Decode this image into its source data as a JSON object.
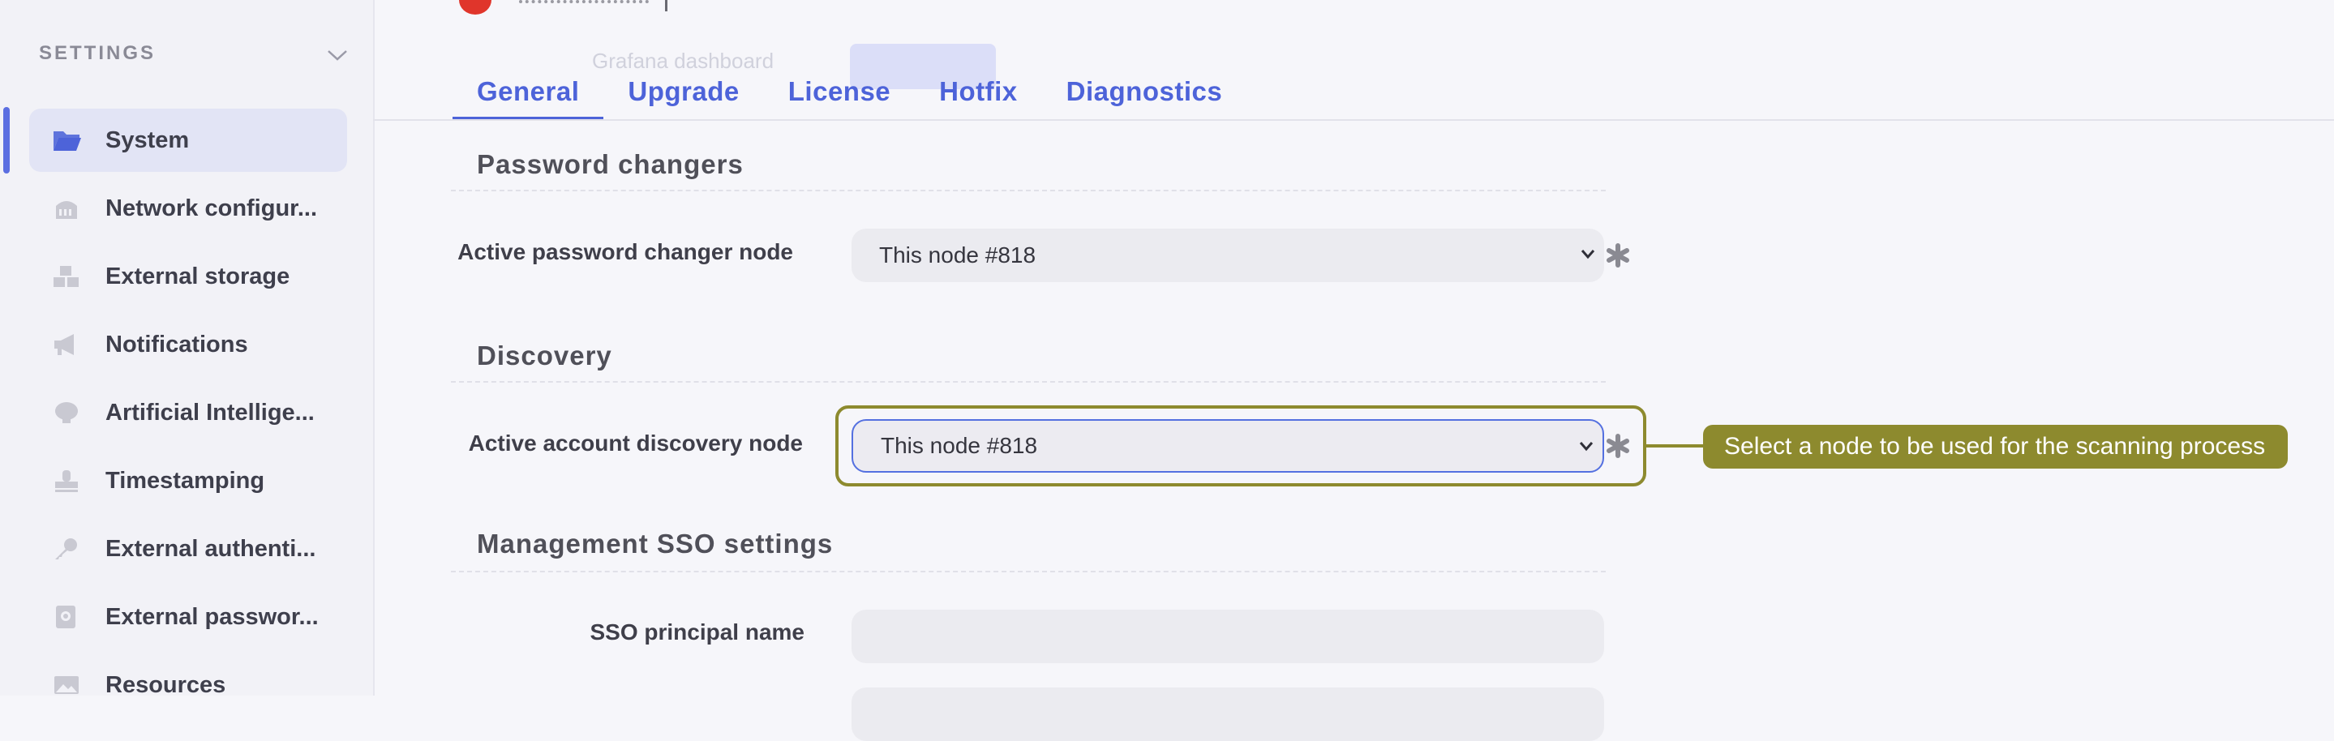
{
  "sidebar": {
    "header": "SETTINGS",
    "items": [
      {
        "label": "System",
        "icon": "folder-icon",
        "active": true
      },
      {
        "label": "Network configur...",
        "icon": "network-icon"
      },
      {
        "label": "External storage",
        "icon": "storage-boxes-icon"
      },
      {
        "label": "Notifications",
        "icon": "megaphone-icon"
      },
      {
        "label": "Artificial Intellige...",
        "icon": "brain-icon"
      },
      {
        "label": "Timestamping",
        "icon": "stamp-icon"
      },
      {
        "label": "External authenti...",
        "icon": "key-icon"
      },
      {
        "label": "External passwor...",
        "icon": "vault-icon"
      },
      {
        "label": "Resources",
        "icon": "image-icon"
      }
    ]
  },
  "background": {
    "ghost_text": "Grafana dashboard"
  },
  "tabs": [
    {
      "label": "General",
      "active": true
    },
    {
      "label": "Upgrade"
    },
    {
      "label": "License"
    },
    {
      "label": "Hotfix"
    },
    {
      "label": "Diagnostics"
    }
  ],
  "sections": {
    "password_changers": {
      "title": "Password changers",
      "field_label": "Active password changer node",
      "value": "This node #818"
    },
    "discovery": {
      "title": "Discovery",
      "field_label": "Active account discovery node",
      "value": "This node #818"
    },
    "sso": {
      "title": "Management SSO settings",
      "field_label": "SSO principal name",
      "value": ""
    }
  },
  "tooltip": "Select a node to be used for the scanning process",
  "colors": {
    "accent": "#4d63d9",
    "highlight": "#8d8a2e",
    "brand_red": "#e0352b"
  }
}
